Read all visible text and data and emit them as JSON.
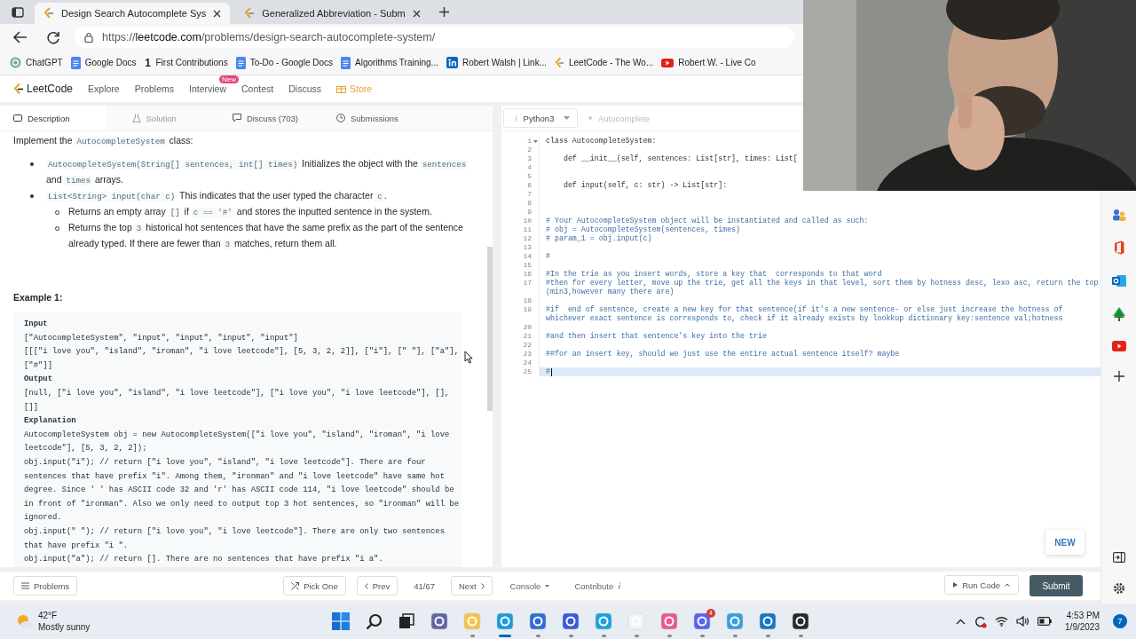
{
  "browser": {
    "tabs": [
      {
        "title": "Design Search Autocomplete Sys",
        "selected": true
      },
      {
        "title": "Generalized Abbreviation - Subm",
        "selected": false
      }
    ],
    "url": {
      "scheme": "https://",
      "host": "leetcode.com",
      "path": "/problems/design-search-autocomplete-system/"
    },
    "bookmarks": [
      {
        "label": "ChatGPT",
        "kind": "knot"
      },
      {
        "label": "Google Docs",
        "kind": "doc"
      },
      {
        "label": "First Contributions",
        "kind": "glyph",
        "glyph": "1"
      },
      {
        "label": "To-Do - Google Docs",
        "kind": "doc"
      },
      {
        "label": "Algorithms Training...",
        "kind": "doc"
      },
      {
        "label": "Robert Walsh | Link...",
        "kind": "profile"
      },
      {
        "label": "LeetCode - The Wo...",
        "kind": "logo"
      },
      {
        "label": "Robert W. - Live Co",
        "kind": "play"
      }
    ]
  },
  "nav": {
    "logo": "LeetCode",
    "items": [
      {
        "label": "Explore",
        "kind": "link"
      },
      {
        "label": "Problems",
        "kind": "link"
      },
      {
        "label": "Interview",
        "kind": "link",
        "badge": "New"
      },
      {
        "label": "Contest",
        "kind": "link"
      },
      {
        "label": "Discuss",
        "kind": "link"
      },
      {
        "label": "Store",
        "kind": "store"
      }
    ]
  },
  "panel_tabs": [
    {
      "label": "Description",
      "kind": "doc",
      "selected": true,
      "disabled": false
    },
    {
      "label": "Solution",
      "kind": "flask",
      "selected": false,
      "disabled": true
    },
    {
      "label": "Discuss (703)",
      "kind": "comment",
      "selected": false,
      "disabled": false
    },
    {
      "label": "Submissions",
      "kind": "clock",
      "selected": false,
      "disabled": false
    }
  ],
  "description": {
    "intro": [
      {
        "kind": "text",
        "text": "Implement the "
      },
      {
        "kind": "code",
        "text": "AutocompleteSystem"
      },
      {
        "kind": "text",
        "text": " class:"
      }
    ],
    "bullets": [
      {
        "segments": [
          {
            "kind": "code",
            "text": "AutocompleteSystem(String[] sentences, int[] times)"
          },
          {
            "kind": "text",
            "text": " Initializes the object with the "
          },
          {
            "kind": "code",
            "text": "sentences"
          },
          {
            "kind": "text",
            "text": " and "
          },
          {
            "kind": "code",
            "text": "times"
          },
          {
            "kind": "text",
            "text": " arrays."
          }
        ]
      },
      {
        "segments": [
          {
            "kind": "code",
            "text": "List<String> input(char c)"
          },
          {
            "kind": "text",
            "text": " This indicates that the user typed the character "
          },
          {
            "kind": "code",
            "text": "c"
          },
          {
            "kind": "text",
            "text": "."
          }
        ],
        "children": [
          {
            "segments": [
              {
                "kind": "text",
                "text": "Returns an empty array "
              },
              {
                "kind": "code",
                "text": "[]"
              },
              {
                "kind": "text",
                "text": " if "
              },
              {
                "kind": "code",
                "text": "c == '#'"
              },
              {
                "kind": "text",
                "text": " and stores the inputted sentence in the system."
              }
            ]
          },
          {
            "segments": [
              {
                "kind": "text",
                "text": "Returns the top "
              },
              {
                "kind": "code",
                "text": "3"
              },
              {
                "kind": "text",
                "text": " historical hot sentences that have the same prefix as the part of the sentence already typed. If there are fewer than "
              },
              {
                "kind": "code",
                "text": "3"
              },
              {
                "kind": "text",
                "text": " matches, return them all."
              }
            ]
          }
        ]
      }
    ],
    "example_title": "Example 1:",
    "example_blocks": [
      {
        "heading": "Input",
        "lines": [
          "[\"AutocompleteSystem\", \"input\", \"input\", \"input\", \"input\"]",
          "[[[\"i love you\", \"island\", \"iroman\", \"i love leetcode\"], [5, 3, 2, 2]], [\"i\"], [\" \"], [\"a\"],",
          "[\"#\"]]"
        ]
      },
      {
        "heading": "Output",
        "lines": [
          "[null, [\"i love you\", \"island\", \"i love leetcode\"], [\"i love you\", \"i love leetcode\"], [],",
          "[]]"
        ]
      },
      {
        "heading": "Explanation",
        "lines": [
          "AutocompleteSystem obj = new AutocompleteSystem([\"i love you\", \"island\", \"iroman\", \"i love",
          "leetcode\"], [5, 3, 2, 2]);",
          "obj.input(\"i\"); // return [\"i love you\", \"island\", \"i love leetcode\"]. There are four",
          "sentences that have prefix \"i\". Among them, \"ironman\" and \"i love leetcode\" have same hot",
          "degree. Since ' ' has ASCII code 32 and 'r' has ASCII code 114, \"i love leetcode\" should be",
          "in front of \"ironman\". Also we only need to output top 3 hot sentences, so \"ironman\" will be",
          "ignored.",
          "obj.input(\" \"); // return [\"i love you\", \"i love leetcode\"]. There are only two sentences",
          "that have prefix \"i \".",
          "obj.input(\"a\"); // return []. There are no sentences that have prefix \"i a\"."
        ]
      }
    ]
  },
  "editor": {
    "language": "Python3",
    "file_tab": "Autocomplete",
    "new_button": "NEW"
  },
  "code_lines": [
    {
      "number": "1",
      "kind": "code",
      "text": "class AutocompleteSystem:",
      "fold": true,
      "current": false
    },
    {
      "number": "2",
      "fold": false,
      "current": false
    },
    {
      "number": "3",
      "kind": "code",
      "text": "    def __init__(self, sentences: List[str], times: List[",
      "fold": false,
      "current": false
    },
    {
      "number": "4",
      "fold": false,
      "current": false
    },
    {
      "number": "5",
      "fold": false,
      "current": false
    },
    {
      "number": "6",
      "kind": "code",
      "text": "    def input(self, c: str) -> List[str]:",
      "fold": false,
      "current": false
    },
    {
      "number": "7",
      "fold": false,
      "current": false
    },
    {
      "number": "8",
      "fold": false,
      "current": false
    },
    {
      "number": "9",
      "fold": false,
      "current": false
    },
    {
      "number": "10",
      "kind": "comment",
      "text": "# Your AutocompleteSystem object will be instantiated and called as such:",
      "fold": false,
      "current": false
    },
    {
      "number": "11",
      "kind": "comment",
      "text": "# obj = AutocompleteSystem(sentences, times)",
      "fold": false,
      "current": false
    },
    {
      "number": "12",
      "kind": "comment",
      "text": "# param_1 = obj.input(c)",
      "fold": false,
      "current": false
    },
    {
      "number": "13",
      "fold": false,
      "current": false
    },
    {
      "number": "14",
      "kind": "comment",
      "text": "#",
      "fold": false,
      "current": false
    },
    {
      "number": "15",
      "fold": false,
      "current": false
    },
    {
      "number": "16",
      "kind": "comment",
      "text": "#In the trie as you insert words, store a key that  corresponds to that word",
      "fold": false,
      "current": false
    },
    {
      "number": "17",
      "kind": "comment",
      "text": "#then for every letter, move up the trie, get all the keys in that level, sort them by hotness desc, lexo asc, return the top",
      "continuation": "(min3,however many there are)",
      "fold": false,
      "current": false
    },
    {
      "number": "18",
      "fold": false,
      "current": false
    },
    {
      "number": "19",
      "kind": "comment",
      "text": "#if  end of sentence, create a new key for that sentence(if it's a new sentence- or else just increase the hotness of",
      "continuation": "whichever exact sentence is corresponds to, check if it already exists by lookkup dictionary key:sentence val;hotness",
      "fold": false,
      "current": false
    },
    {
      "number": "20",
      "fold": false,
      "current": false
    },
    {
      "number": "21",
      "kind": "comment",
      "text": "#and then insert that sentence's key into the trie",
      "fold": false,
      "current": false
    },
    {
      "number": "22",
      "fold": false,
      "current": false
    },
    {
      "number": "23",
      "kind": "comment",
      "text": "##for an insert key, should we just use the entire actual sentence itself? maybe",
      "fold": false,
      "current": false
    },
    {
      "number": "24",
      "fold": false,
      "current": false
    },
    {
      "number": "25",
      "kind": "comment",
      "text": "#",
      "fold": false,
      "current": true
    }
  ],
  "bottom_bar": {
    "problems": "Problems",
    "pick_one": "Pick One",
    "prev": "Prev",
    "position": "41/67",
    "next": "Next",
    "console": "Console",
    "contribute": "Contribute",
    "run_code": "Run Code",
    "submit": "Submit"
  },
  "taskbar": {
    "temperature": "42°F",
    "weather": "Mostly sunny",
    "apps": [
      {
        "kind": "start",
        "running": false,
        "active": false
      },
      {
        "kind": "search",
        "running": false,
        "active": false
      },
      {
        "kind": "taskview",
        "running": false,
        "active": false
      },
      {
        "kind": "chat",
        "running": false,
        "active": false
      },
      {
        "kind": "folder",
        "running": true,
        "active": false
      },
      {
        "kind": "browser",
        "running": true,
        "active": true
      },
      {
        "kind": "store",
        "running": true,
        "active": false
      },
      {
        "kind": "editor",
        "running": true,
        "active": false
      },
      {
        "kind": "ring",
        "running": true,
        "active": false
      },
      {
        "kind": "music",
        "running": true,
        "active": false
      },
      {
        "kind": "gem",
        "running": true,
        "active": false
      },
      {
        "kind": "gamepad",
        "running": true,
        "active": false,
        "badge": "4"
      },
      {
        "kind": "notepad",
        "running": true,
        "active": false
      },
      {
        "kind": "camera",
        "running": true,
        "active": false
      },
      {
        "kind": "record",
        "running": true,
        "active": false
      }
    ],
    "time": "4:53 PM",
    "date": "1/9/2023",
    "notifications": "7"
  }
}
